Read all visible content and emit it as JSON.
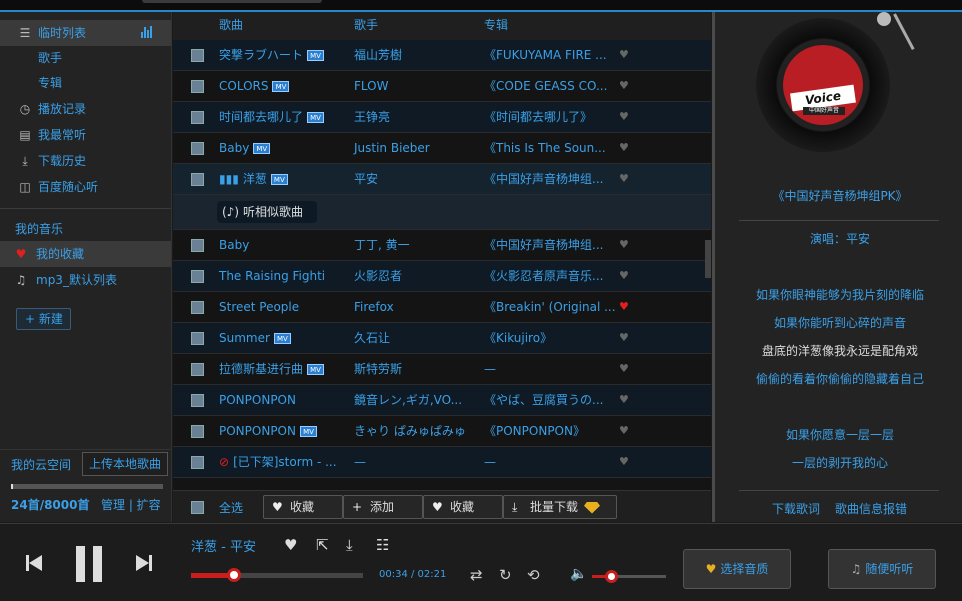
{
  "sidebar": {
    "items": [
      {
        "label": "临时列表",
        "icon": "list-icon"
      },
      {
        "label": "歌手"
      },
      {
        "label": "专辑"
      },
      {
        "label": "播放记录",
        "icon": "history-icon"
      },
      {
        "label": "我最常听",
        "icon": "frequent-icon"
      },
      {
        "label": "下载历史",
        "icon": "download-icon"
      },
      {
        "label": "百度随心听",
        "icon": "radio-icon"
      }
    ],
    "my_music_title": "我的音乐",
    "favorites": "我的收藏",
    "playlist": "mp3_默认列表",
    "new_label": "新建",
    "cloud_label": "我的云空间",
    "upload_label": "上传本地歌曲",
    "cloud_usage": 0.003,
    "cloud_count": "24首/8000首",
    "manage_label": "管理 | 扩容"
  },
  "list": {
    "headers": {
      "name": "歌曲",
      "artist": "歌手",
      "album": "专辑"
    },
    "rows": [
      {
        "name": "突撃ラブハート",
        "mv": "MV",
        "artist": "福山芳樹",
        "album": "《FUKUYAMA FIRE ...",
        "fav": false
      },
      {
        "name": "COLORS",
        "mv": "MV",
        "artist": "FLOW",
        "album": "《CODE GEASS CO...",
        "fav": false
      },
      {
        "name": "时间都去哪儿了",
        "mv": "MV",
        "artist": "王铮亮",
        "album": "《时间都去哪儿了》",
        "fav": false
      },
      {
        "name": "Baby",
        "mv": "MV",
        "artist": "Justin Bieber",
        "album": "《This Is The Soun...",
        "fav": false
      },
      {
        "name": "洋葱",
        "mv": "MV",
        "artist": "平安",
        "album": "《中国好声音杨坤组...",
        "fav": false
      },
      {
        "name": "Baby",
        "mv": "",
        "artist": "丁丁, 黄一",
        "album": "《中国好声音杨坤组...",
        "fav": false
      },
      {
        "name": "The Raising Fighti",
        "mv": "",
        "artist": "火影忍者",
        "album": "《火影忍者原声音乐...",
        "fav": false
      },
      {
        "name": "Street People",
        "mv": "",
        "artist": "Firefox",
        "album": "《Breakin' (Original ...",
        "fav": true
      },
      {
        "name": "Summer",
        "mv": "MV",
        "artist": "久石让",
        "album": "《Kikujiro》",
        "fav": false
      },
      {
        "name": "拉德斯基进行曲",
        "mv": "MV",
        "artist": "斯特劳斯",
        "album": "—",
        "fav": false
      },
      {
        "name": "PONPONPON",
        "mv": "",
        "artist": "鏡音レン,ギガ,VO...",
        "album": "《やば、豆腐買うの...",
        "fav": false
      },
      {
        "name": "PONPONPON",
        "mv": "MV",
        "artist": "きゃり ぱみゅぱみゅ",
        "album": "《PONPONPON》",
        "fav": false
      },
      {
        "name": "[已下架]storm - ...",
        "mv": "",
        "artist": "—",
        "album": "—",
        "fav": false
      }
    ],
    "similar_label": "听相似歌曲",
    "select_all": "全选",
    "btn_fav": "收藏",
    "btn_add": "添加",
    "btn_fav2": "收藏",
    "btn_batch": "批量下载"
  },
  "right": {
    "disc_text": "Voice",
    "disc_sub": "中国好声音",
    "album": "《中国好声音杨坤组PK》",
    "singer": "演唱：平安",
    "lyrics": [
      "如果你眼神能够为我片刻的降临",
      "如果你能听到心碎的声音",
      "盘底的洋葱像我永远是配角戏",
      "偷偷的看着你偷偷的隐藏着自己",
      "如果你愿意一层一层",
      "一层的剥开我的心"
    ],
    "download_lyrics": "下载歌词",
    "report": "歌曲信息报错"
  },
  "player": {
    "now_playing": "洋葱 - 平安",
    "progress": 0.25,
    "time": "00:34 / 02:21",
    "volume": 0.25,
    "quality_label": "选择音质",
    "radio_label": "随便听听"
  }
}
